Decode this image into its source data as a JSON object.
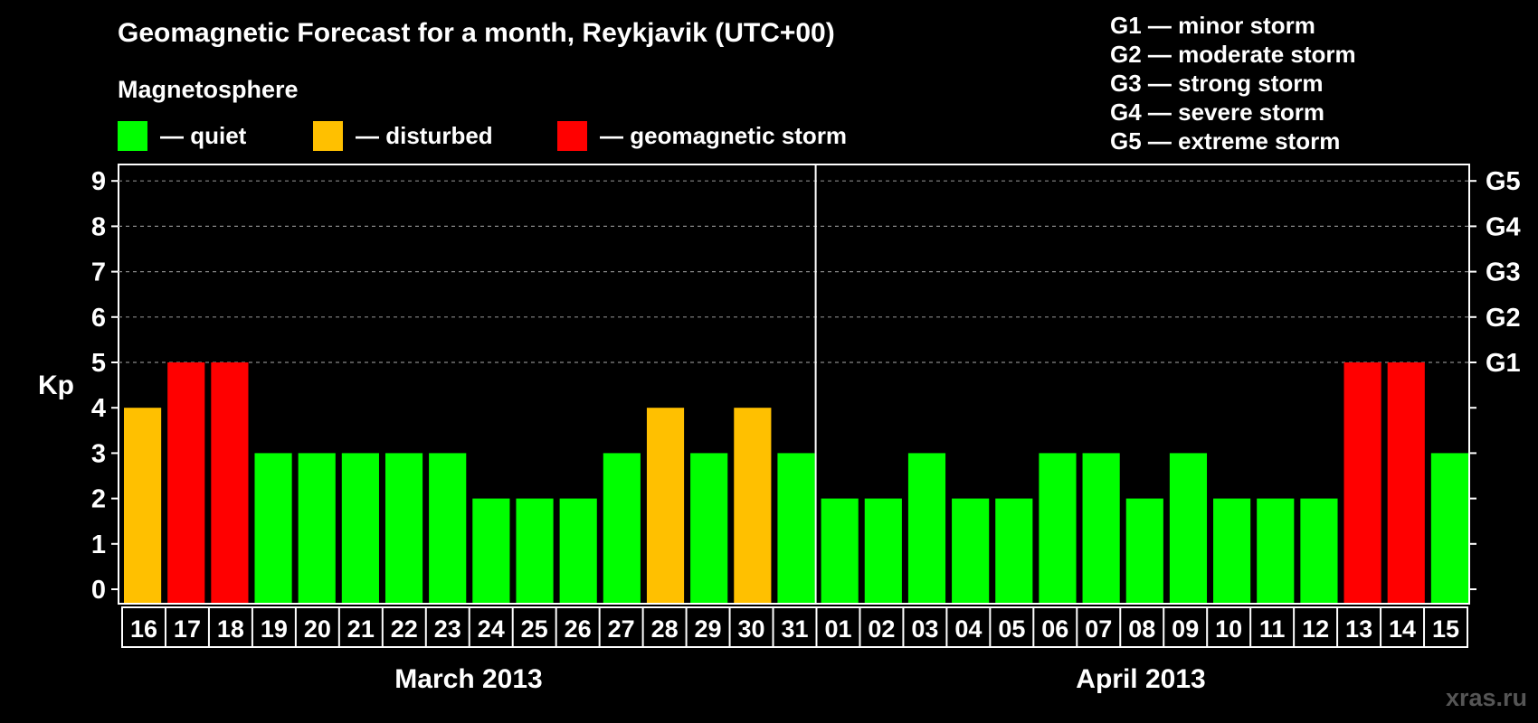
{
  "title": "Geomagnetic Forecast for a month, Reykjavik (UTC+00)",
  "legend": {
    "heading": "Magnetosphere",
    "items": [
      {
        "label": "— quiet",
        "color": "#00ff00"
      },
      {
        "label": "— disturbed",
        "color": "#ffc000"
      },
      {
        "label": "— geomagnetic storm",
        "color": "#ff0000"
      }
    ]
  },
  "g_scale": [
    "G1 — minor storm",
    "G2 — moderate storm",
    "G3 — strong storm",
    "G4 — severe storm",
    "G5 — extreme storm"
  ],
  "months": [
    "March 2013",
    "April 2013"
  ],
  "watermark": "xras.ru",
  "chart_data": {
    "type": "bar",
    "ylabel": "Kp",
    "ylim": [
      0,
      9
    ],
    "yticks": [
      "0",
      "1",
      "2",
      "3",
      "4",
      "5",
      "6",
      "7",
      "8",
      "9"
    ],
    "right_ticks": [
      {
        "value": 5,
        "label": "G1"
      },
      {
        "value": 6,
        "label": "G2"
      },
      {
        "value": 7,
        "label": "G3"
      },
      {
        "value": 8,
        "label": "G4"
      },
      {
        "value": 9,
        "label": "G5"
      }
    ],
    "grid": "dashed horizontal at 5-9",
    "categories": [
      "16",
      "17",
      "18",
      "19",
      "20",
      "21",
      "22",
      "23",
      "24",
      "25",
      "26",
      "27",
      "28",
      "29",
      "30",
      "31",
      "01",
      "02",
      "03",
      "04",
      "05",
      "06",
      "07",
      "08",
      "09",
      "10",
      "11",
      "12",
      "13",
      "14",
      "15"
    ],
    "values": [
      4,
      5,
      5,
      3,
      3,
      3,
      3,
      3,
      2,
      2,
      2,
      3,
      4,
      3,
      4,
      3,
      2,
      2,
      3,
      2,
      2,
      3,
      3,
      2,
      3,
      2,
      2,
      2,
      5,
      5,
      3
    ],
    "colors": {
      "quiet": "#00ff00",
      "disturbed": "#ffc000",
      "storm": "#ff0000"
    }
  }
}
